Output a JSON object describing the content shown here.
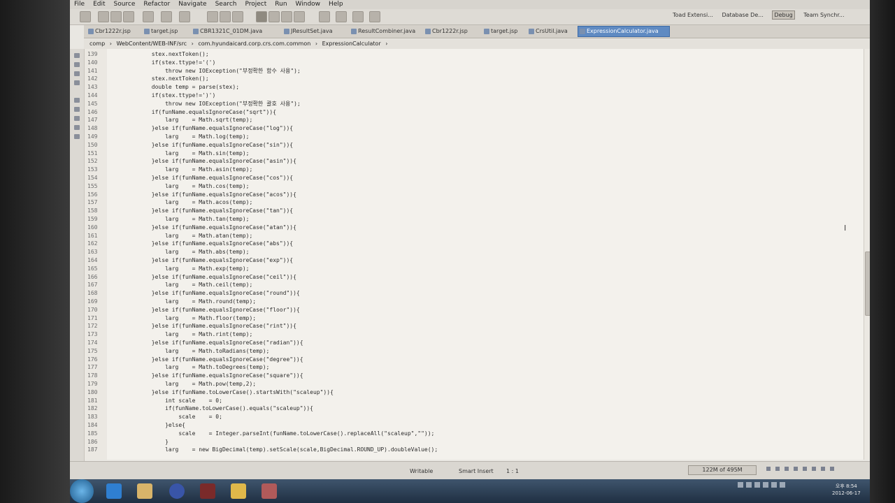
{
  "menu": [
    "File",
    "Edit",
    "Source",
    "Refactor",
    "Navigate",
    "Search",
    "Project",
    "Run",
    "Window",
    "Help"
  ],
  "perspectives": {
    "toad": "Toad Extensi...",
    "database": "Database De...",
    "debug": "Debug",
    "team": "Team Synchr..."
  },
  "tabs": [
    {
      "label": "Cbr1222r.jsp",
      "active": false
    },
    {
      "label": "target.jsp",
      "active": false
    },
    {
      "label": "CBR1321C_01DM.java",
      "active": false
    },
    {
      "label": "JResultSet.java",
      "active": false
    },
    {
      "label": "ResultCombiner.java",
      "active": false
    },
    {
      "label": "Cbr1222r.jsp",
      "active": false
    },
    {
      "label": "target.jsp",
      "active": false
    },
    {
      "label": "CrsUtil.java",
      "active": false
    },
    {
      "label": "ExpressionCalculator.java",
      "active": true
    }
  ],
  "breadcrumb": [
    "comp",
    "WebContent/WEB-INF/src",
    "com.hyundaicard.corp.crs.com.common",
    "ExpressionCalculator"
  ],
  "lines": [
    {
      "n": "139",
      "t": "            stex.nextToken();"
    },
    {
      "n": "140",
      "t": "            if(stex.ttype!='(')"
    },
    {
      "n": "141",
      "t": "                throw new IOException(\"부정확한 함수 사용\");"
    },
    {
      "n": "142",
      "t": "            stex.nextToken();"
    },
    {
      "n": "143",
      "t": "            double temp = parse(stex);"
    },
    {
      "n": "144",
      "t": "            if(stex.ttype!=')')"
    },
    {
      "n": "145",
      "t": "                throw new IOException(\"부정확한 괄호 사용\");"
    },
    {
      "n": "146",
      "t": "            if(funName.equalsIgnoreCase(\"sqrt\")){"
    },
    {
      "n": "147",
      "t": "                larg    = Math.sqrt(temp);"
    },
    {
      "n": "148",
      "t": "            }else if(funName.equalsIgnoreCase(\"log\")){"
    },
    {
      "n": "149",
      "t": "                larg    = Math.log(temp);"
    },
    {
      "n": "150",
      "t": "            }else if(funName.equalsIgnoreCase(\"sin\")){"
    },
    {
      "n": "151",
      "t": "                larg    = Math.sin(temp);"
    },
    {
      "n": "152",
      "t": "            }else if(funName.equalsIgnoreCase(\"asin\")){"
    },
    {
      "n": "153",
      "t": "                larg    = Math.asin(temp);"
    },
    {
      "n": "154",
      "t": "            }else if(funName.equalsIgnoreCase(\"cos\")){"
    },
    {
      "n": "155",
      "t": "                larg    = Math.cos(temp);"
    },
    {
      "n": "156",
      "t": "            }else if(funName.equalsIgnoreCase(\"acos\")){"
    },
    {
      "n": "157",
      "t": "                larg    = Math.acos(temp);"
    },
    {
      "n": "158",
      "t": "            }else if(funName.equalsIgnoreCase(\"tan\")){"
    },
    {
      "n": "159",
      "t": "                larg    = Math.tan(temp);"
    },
    {
      "n": "160",
      "t": "            }else if(funName.equalsIgnoreCase(\"atan\")){"
    },
    {
      "n": "161",
      "t": "                larg    = Math.atan(temp);"
    },
    {
      "n": "162",
      "t": "            }else if(funName.equalsIgnoreCase(\"abs\")){"
    },
    {
      "n": "163",
      "t": "                larg    = Math.abs(temp);"
    },
    {
      "n": "164",
      "t": "            }else if(funName.equalsIgnoreCase(\"exp\")){"
    },
    {
      "n": "165",
      "t": "                larg    = Math.exp(temp);"
    },
    {
      "n": "166",
      "t": "            }else if(funName.equalsIgnoreCase(\"ceil\")){"
    },
    {
      "n": "167",
      "t": "                larg    = Math.ceil(temp);"
    },
    {
      "n": "168",
      "t": "            }else if(funName.equalsIgnoreCase(\"round\")){"
    },
    {
      "n": "169",
      "t": "                larg    = Math.round(temp);"
    },
    {
      "n": "170",
      "t": "            }else if(funName.equalsIgnoreCase(\"floor\")){"
    },
    {
      "n": "171",
      "t": "                larg    = Math.floor(temp);"
    },
    {
      "n": "172",
      "t": "            }else if(funName.equalsIgnoreCase(\"rint\")){"
    },
    {
      "n": "173",
      "t": "                larg    = Math.rint(temp);"
    },
    {
      "n": "174",
      "t": "            }else if(funName.equalsIgnoreCase(\"radian\")){"
    },
    {
      "n": "175",
      "t": "                larg    = Math.toRadians(temp);"
    },
    {
      "n": "176",
      "t": "            }else if(funName.equalsIgnoreCase(\"degree\")){"
    },
    {
      "n": "177",
      "t": "                larg    = Math.toDegrees(temp);"
    },
    {
      "n": "178",
      "t": "            }else if(funName.equalsIgnoreCase(\"square\")){"
    },
    {
      "n": "179",
      "t": "                larg    = Math.pow(temp,2);"
    },
    {
      "n": "180",
      "t": "            }else if(funName.toLowerCase().startsWith(\"scaleup\")){"
    },
    {
      "n": "181",
      "t": "                int scale    = 0;"
    },
    {
      "n": "182",
      "t": "                if(funName.toLowerCase().equals(\"scaleup\")){"
    },
    {
      "n": "183",
      "t": "                    scale    = 0;"
    },
    {
      "n": "184",
      "t": "                }else{"
    },
    {
      "n": "185",
      "t": "                    scale    = Integer.parseInt(funName.toLowerCase().replaceAll(\"scaleup\",\"\"));"
    },
    {
      "n": "186",
      "t": "                }"
    },
    {
      "n": "187",
      "t": "                larg    = new BigDecimal(temp).setScale(scale,BigDecimal.ROUND_UP).doubleValue();"
    }
  ],
  "status": {
    "writable": "Writable",
    "insert": "Smart Insert",
    "position": "1 : 1",
    "memory": "122M of 495M"
  },
  "clock": {
    "time": "오후 8:54",
    "date": "2012-06-17"
  }
}
